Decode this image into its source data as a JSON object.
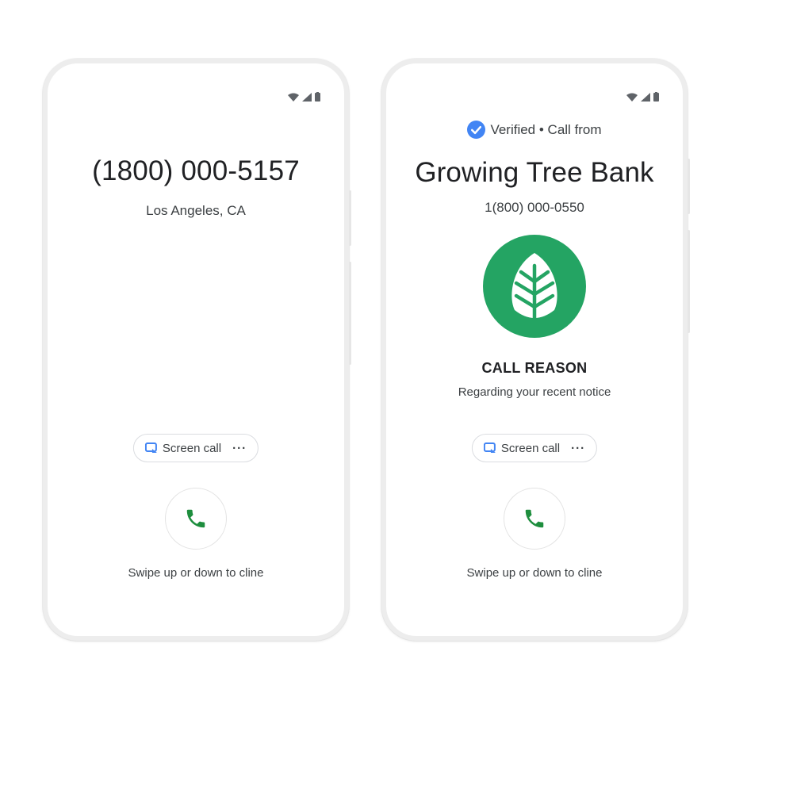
{
  "colors": {
    "accent_green": "#24a463",
    "verified_blue": "#4285f4",
    "screen_call_blue": "#4285f4",
    "phone_frame": "#ededed"
  },
  "icons": {
    "status": [
      "wifi-icon",
      "signal-icon",
      "battery-icon"
    ],
    "verified": "check-circle-icon",
    "screen_call": "screen-call-icon",
    "more": "more-horiz-icon",
    "answer": "phone-icon",
    "logo": "leaf-icon"
  },
  "left_phone": {
    "number": "(1800) 000-5157",
    "location": "Los Angeles, CA",
    "screen_call_label": "Screen call",
    "more_label": "···",
    "swipe_hint": "Swipe up or down to cline"
  },
  "right_phone": {
    "verified_label": "Verified • Call from",
    "caller_name": "Growing Tree Bank",
    "caller_number": "1(800) 000-0550",
    "reason_heading": "CALL REASON",
    "reason_text": "Regarding your recent notice",
    "screen_call_label": "Screen call",
    "more_label": "···",
    "swipe_hint": "Swipe up or down to cline"
  }
}
